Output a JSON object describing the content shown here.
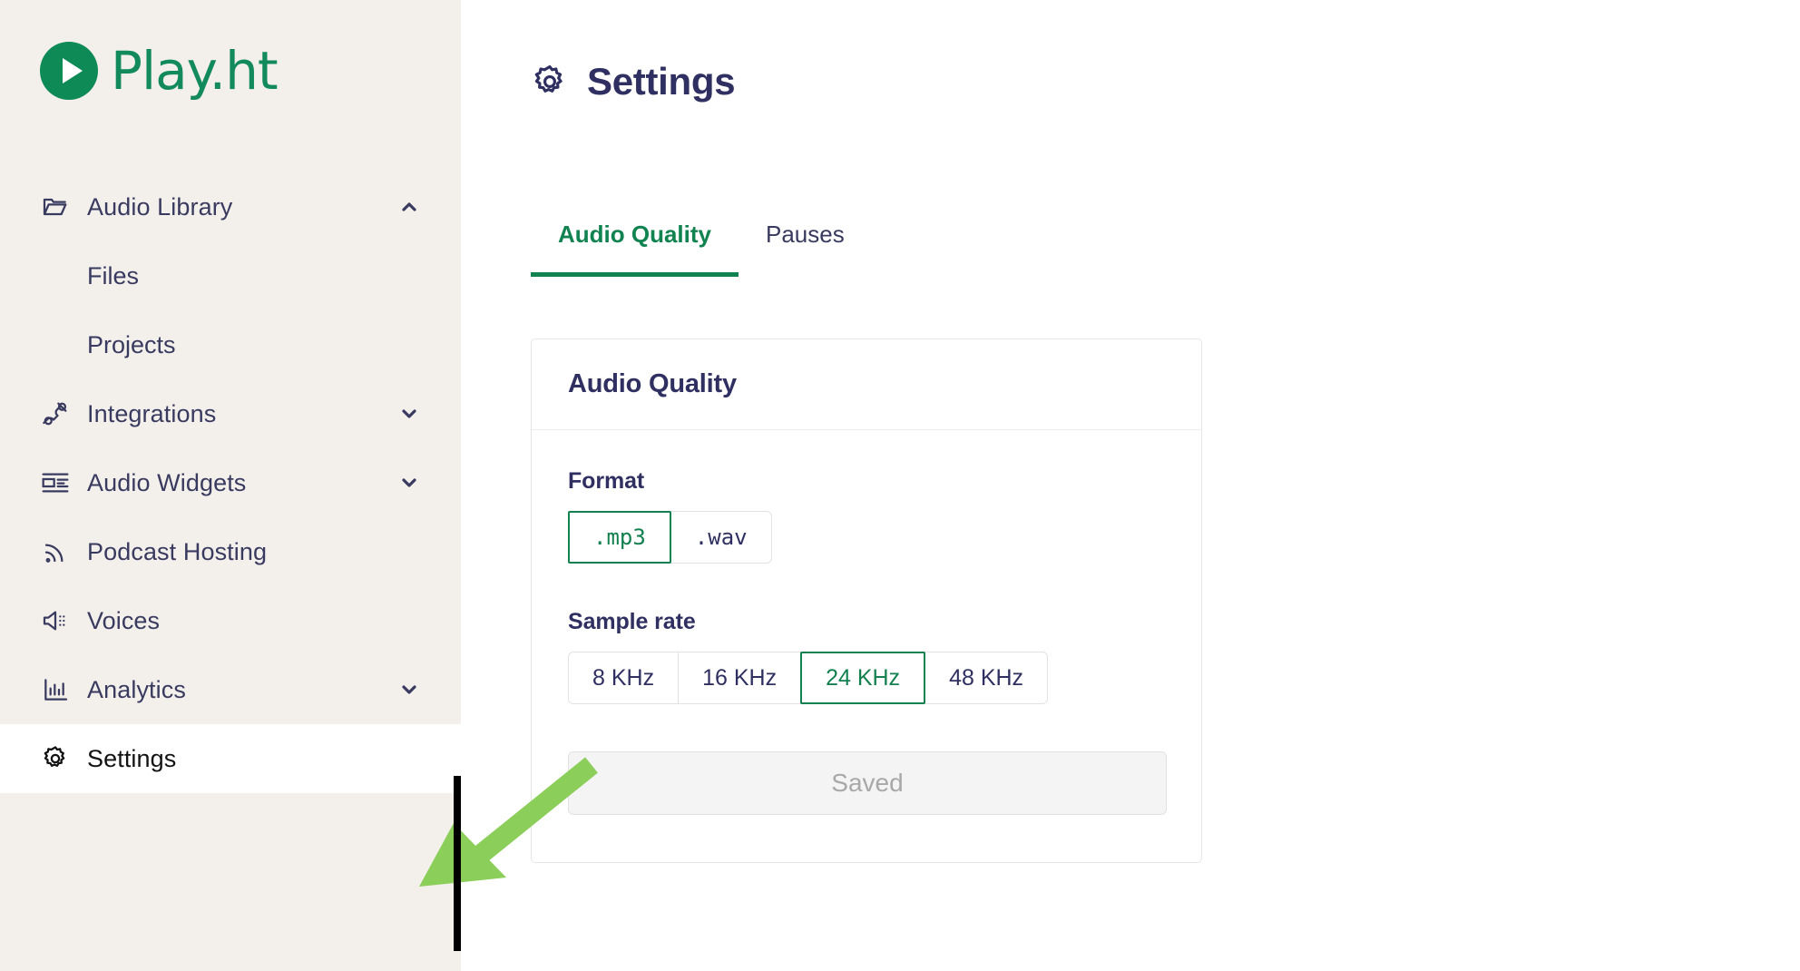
{
  "brand": {
    "name": "Play.ht",
    "logo_icon": "play-circle-icon",
    "accent_green": "#12804F",
    "logo_green": "#138A5B",
    "navy": "#2F3061",
    "sidebar_bg": "#F3F0EB",
    "annotation_green": "#8CCE5A"
  },
  "sidebar": {
    "items": [
      {
        "label": "Audio Library",
        "icon": "folder-open-icon",
        "chevron": "chevron-up-icon",
        "active": false
      },
      {
        "label": "Files",
        "icon": "",
        "chevron": "",
        "active": false,
        "sub": true
      },
      {
        "label": "Projects",
        "icon": "",
        "chevron": "",
        "active": false,
        "sub": true
      },
      {
        "label": "Integrations",
        "icon": "plug-icon",
        "chevron": "chevron-down-icon",
        "active": false
      },
      {
        "label": "Audio Widgets",
        "icon": "widget-icon",
        "chevron": "chevron-down-icon",
        "active": false
      },
      {
        "label": "Podcast Hosting",
        "icon": "rss-icon",
        "chevron": "",
        "active": false
      },
      {
        "label": "Voices",
        "icon": "speaker-icon",
        "chevron": "",
        "active": false
      },
      {
        "label": "Analytics",
        "icon": "bar-chart-icon",
        "chevron": "chevron-down-icon",
        "active": false
      },
      {
        "label": "Settings",
        "icon": "gear-icon",
        "chevron": "",
        "active": true
      }
    ]
  },
  "header": {
    "title": "Settings",
    "icon": "gear-icon"
  },
  "tabs": [
    {
      "label": "Audio Quality",
      "active": true
    },
    {
      "label": "Pauses",
      "active": false
    }
  ],
  "card": {
    "title": "Audio Quality",
    "format": {
      "label": "Format",
      "options": [
        {
          "label": ".mp3",
          "selected": true
        },
        {
          "label": ".wav",
          "selected": false
        }
      ]
    },
    "sample_rate": {
      "label": "Sample rate",
      "options": [
        {
          "label": "8 KHz",
          "selected": false
        },
        {
          "label": "16 KHz",
          "selected": false
        },
        {
          "label": "24 KHz",
          "selected": true
        },
        {
          "label": "48 KHz",
          "selected": false
        }
      ]
    },
    "save_button": {
      "label": "Saved",
      "disabled": true
    }
  },
  "annotation": {
    "arrow_icon": "arrow-down-left-icon",
    "caret_icon": "text-caret-bar"
  }
}
